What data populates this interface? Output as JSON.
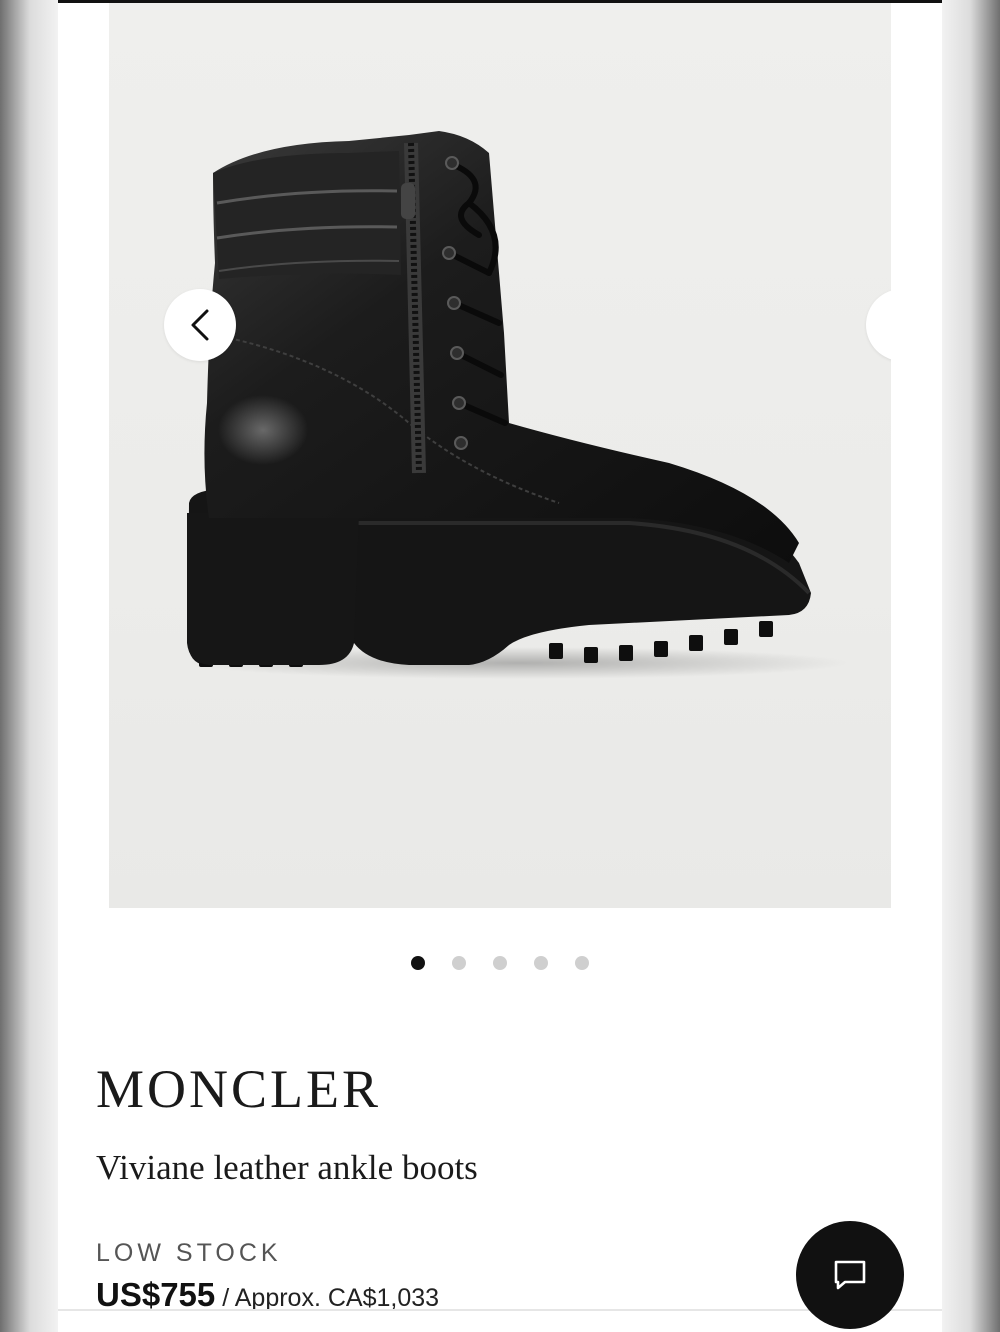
{
  "gallery": {
    "image_alt": "Black leather lace-up ankle boot with side zip and lug sole",
    "prev_icon": "chevron-left-icon",
    "next_icon": "chevron-right-icon",
    "slide_count": 5,
    "active_slide": 1
  },
  "product": {
    "brand": "MONCLER",
    "name": "Viviane leather ankle boots",
    "stock_status": "LOW STOCK",
    "price": "US$755",
    "price_separator": " / ",
    "approx_price": "Approx. CA$1,033"
  },
  "chat": {
    "icon": "chat-bubble-icon"
  },
  "colors": {
    "accent": "#111111",
    "dot_inactive": "#cfcfcf",
    "background": "#ffffff"
  }
}
